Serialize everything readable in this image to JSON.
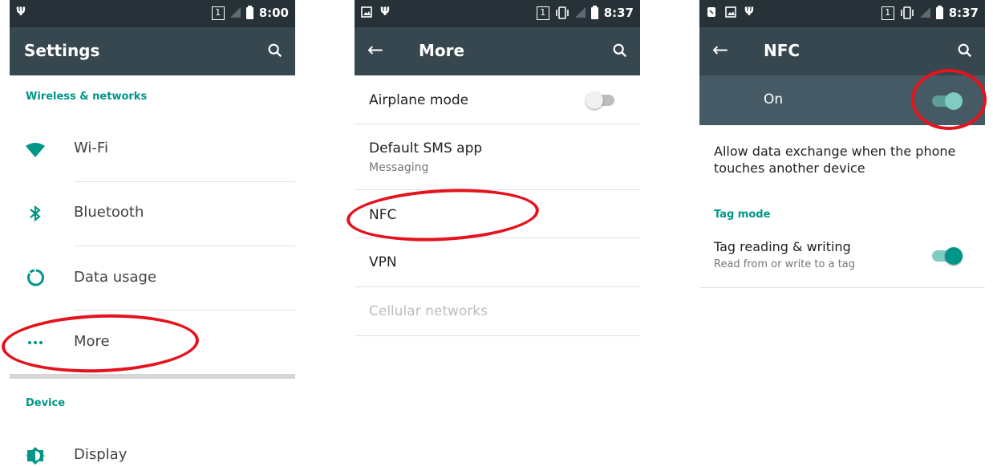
{
  "screens": [
    {
      "status": {
        "time": "8:00",
        "sim": "1"
      },
      "appbar": {
        "title": "Settings"
      },
      "section_wireless": "Wireless & networks",
      "items": [
        {
          "label": "Wi-Fi",
          "icon": "wifi-icon"
        },
        {
          "label": "Bluetooth",
          "icon": "bluetooth-icon"
        },
        {
          "label": "Data usage",
          "icon": "data-usage-icon"
        },
        {
          "label": "More",
          "icon": "more-dots-icon"
        }
      ],
      "section_device": "Device",
      "device_items": [
        {
          "label": "Display",
          "icon": "display-brightness-icon"
        }
      ]
    },
    {
      "status": {
        "time": "8:37",
        "sim": "1"
      },
      "appbar": {
        "title": "More"
      },
      "items": [
        {
          "label": "Airplane mode",
          "toggle": "off"
        },
        {
          "label": "Default SMS app",
          "sub": "Messaging"
        },
        {
          "label": "NFC"
        },
        {
          "label": "VPN"
        },
        {
          "label": "Cellular networks",
          "disabled": true
        }
      ]
    },
    {
      "status": {
        "time": "8:37",
        "sim": "1"
      },
      "appbar": {
        "title": "NFC"
      },
      "master": {
        "label": "On",
        "toggle": "on"
      },
      "description": "Allow data exchange when the phone touches another device",
      "section_tag": "Tag mode",
      "tag_item": {
        "label": "Tag reading & writing",
        "sub": "Read from or write to a tag",
        "toggle": "on"
      }
    }
  ],
  "colors": {
    "accent": "#009688",
    "appbar": "#37474f",
    "statusbar": "#263238",
    "highlight": "#e4131d"
  }
}
